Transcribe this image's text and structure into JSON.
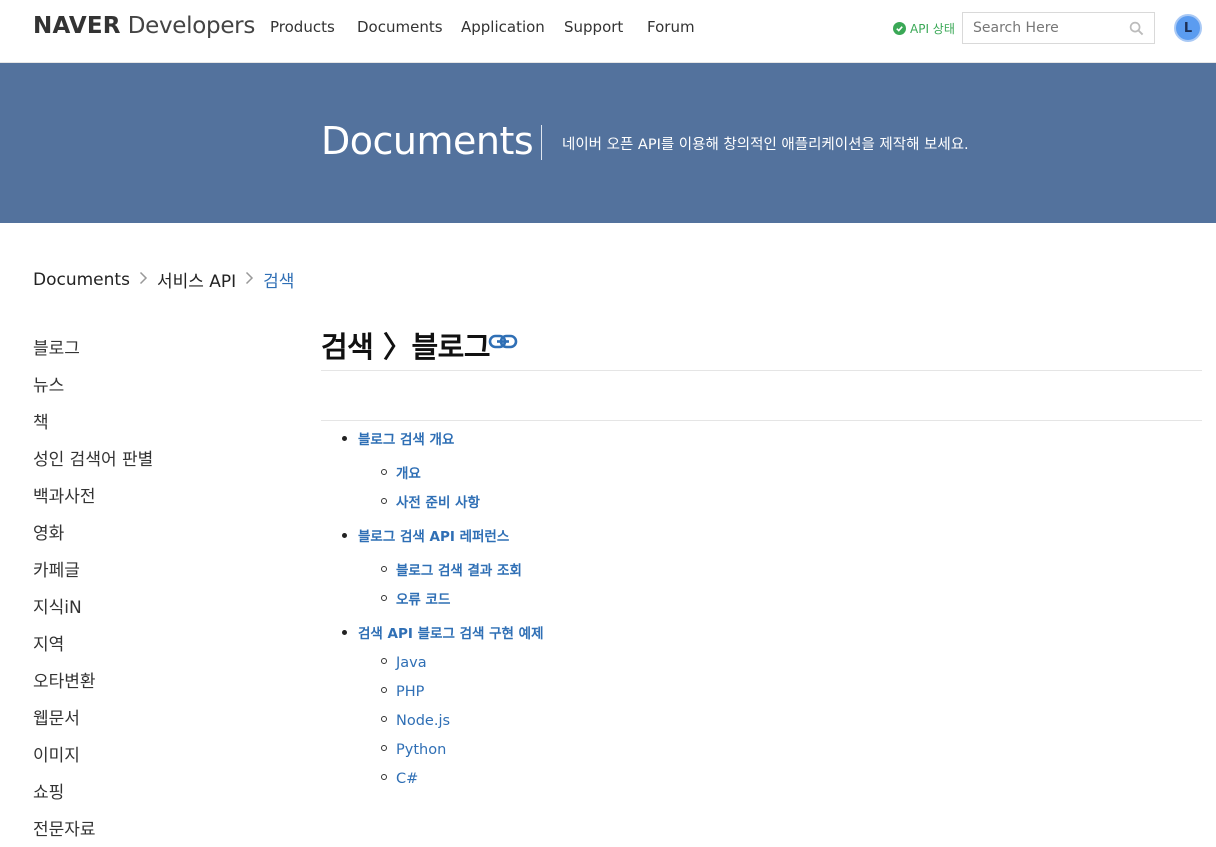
{
  "header": {
    "logo_brand": "NAVER",
    "logo_rest": " Developers",
    "nav": [
      "Products",
      "Documents",
      "Application",
      "Support",
      "Forum"
    ],
    "api_status": "API 상태",
    "search_placeholder": "Search Here",
    "avatar_letter": "L",
    "status_color": "#3aa856",
    "avatar_color": "#5b9cf0"
  },
  "banner": {
    "title": "Documents",
    "subtitle": "네이버 오픈 API를 이용해 창의적인 애플리케이션을 제작해 보세요.",
    "background": "#53729d"
  },
  "breadcrumb": [
    "Documents",
    "서비스 API",
    "검색"
  ],
  "sidebar": {
    "items": [
      "블로그",
      "뉴스",
      "책",
      "성인 검색어 판별",
      "백과사전",
      "영화",
      "카페글",
      "지식iN",
      "지역",
      "오타변환",
      "웹문서",
      "이미지",
      "쇼핑",
      "전문자료"
    ]
  },
  "content": {
    "title": "검색 〉블로그",
    "link_color": "#2f6fb5",
    "toc": [
      {
        "label": "블로그 검색 개요",
        "children": [
          "개요",
          "사전 준비 사항"
        ]
      },
      {
        "label": "블로그 검색 API 레퍼런스",
        "children": [
          "블로그 검색 결과 조회",
          "오류 코드"
        ]
      },
      {
        "label": "검색 API 블로그 검색 구현 예제",
        "children": [
          "Java",
          "PHP",
          "Node.js",
          "Python",
          "C#"
        ]
      }
    ]
  }
}
